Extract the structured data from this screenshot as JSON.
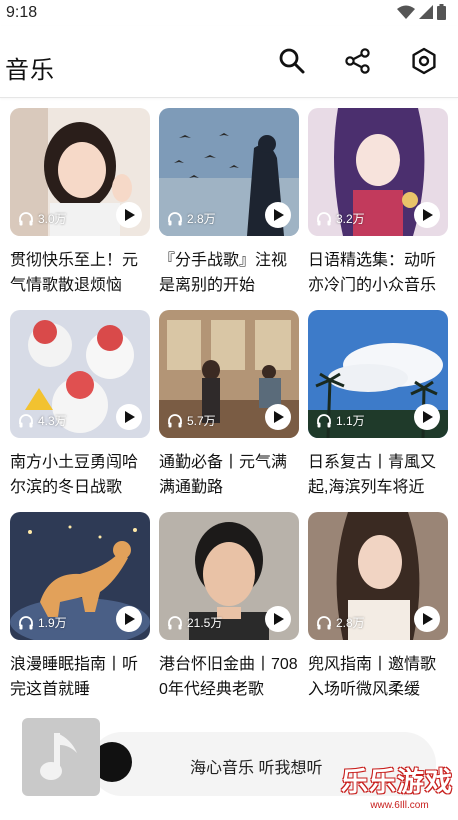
{
  "status_bar": {
    "time": "9:18",
    "icons": [
      "wifi-icon",
      "signal-icon",
      "battery-icon"
    ]
  },
  "app_bar": {
    "title": "音乐",
    "actions": [
      "search-icon",
      "share-icon",
      "settings-icon"
    ]
  },
  "playlists": [
    {
      "plays": "3.0万",
      "title": "贯彻快乐至上！元气情歌散退烦恼"
    },
    {
      "plays": "2.8万",
      "title": "『分手战歌』注视是离别的开始"
    },
    {
      "plays": "3.2万",
      "title": "日语精选集：动听亦冷门的小众音乐"
    },
    {
      "plays": "4.3万",
      "title": "南方小土豆勇闯哈尔滨的冬日战歌"
    },
    {
      "plays": "5.7万",
      "title": "通勤必备丨元气满满通勤路"
    },
    {
      "plays": "1.1万",
      "title": "日系复古丨青風又起,海滨列车将近"
    },
    {
      "plays": "1.9万",
      "title": "浪漫睡眠指南丨听完这首就睡"
    },
    {
      "plays": "21.5万",
      "title": "港台怀旧金曲丨7080年代经典老歌"
    },
    {
      "plays": "2.8万",
      "title": "兜风指南丨邀情歌入场听微风柔缓"
    }
  ],
  "player": {
    "text": "海心音乐 听我想听"
  },
  "watermark": {
    "text": "乐乐游戏",
    "url": "www.6Ill.com"
  },
  "colors": {
    "accent": "#111111",
    "watermark": "#c8201e",
    "player_bg": "#f4f4f4"
  }
}
